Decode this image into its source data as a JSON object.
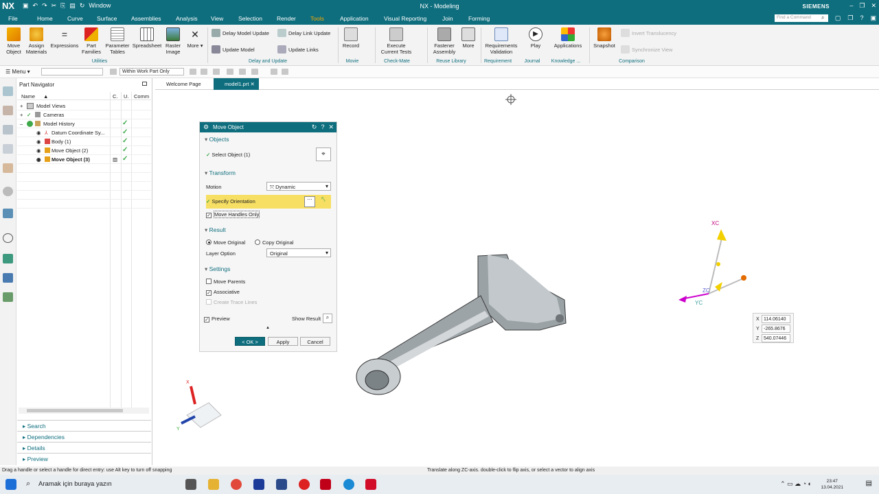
{
  "app": {
    "logo": "NX",
    "title": "NX - Modeling",
    "brand": "SIEMENS",
    "window_menu": "Window"
  },
  "menu_tabs": [
    "File",
    "Home",
    "Curve",
    "Surface",
    "Assemblies",
    "Analysis",
    "View",
    "Selection",
    "Render",
    "Tools",
    "Application",
    "Visual Reporting",
    "Join",
    "Forming"
  ],
  "active_tab": "Tools",
  "find_placeholder": "Find a Command",
  "ribbon": {
    "buttons": [
      "Move Object",
      "Assign Materials",
      "Expressions",
      "Part Families",
      "Parameter Tables",
      "Spreadsheet",
      "Raster Image",
      "More"
    ],
    "delay": [
      "Delay Model Update",
      "Delay Link Update",
      "Update Model",
      "Update Links"
    ],
    "record": "Record",
    "execute": "Execute Current Tests",
    "fastener": "Fastener Assembly",
    "more2": "More",
    "req": "Requirements Validation",
    "play": "Play",
    "applications": "Applications",
    "snapshot": "Snapshot",
    "invert": "Invert Translucency",
    "sync": "Synchronize View",
    "groups": [
      "Utilities",
      "Delay and Update",
      "Movie",
      "Check-Mate",
      "Reuse Library",
      "Requirement",
      "Journal",
      "Knowledge ...",
      "Comparison"
    ]
  },
  "toolbar": {
    "menu": "Menu",
    "scope": "Within Work Part Only"
  },
  "navigator": {
    "title": "Part Navigator",
    "cols": [
      "Name",
      "C.",
      "U.",
      "Comm"
    ],
    "rows": [
      "Model Views",
      "Cameras",
      "Model History",
      "Datum Coordinate Sy...",
      "Body (1)",
      "Move Object (2)",
      "Move Object (3)"
    ],
    "sections": [
      "Search",
      "Dependencies",
      "Details",
      "Preview"
    ]
  },
  "doctabs": [
    "Welcome Page",
    "model1.prt"
  ],
  "dialog": {
    "title": "Move Object",
    "objects": "Objects",
    "select_object": "Select Object (1)",
    "transform": "Transform",
    "motion_label": "Motion",
    "motion_value": "Dynamic",
    "specify_orientation": "Specify Orientation",
    "move_handles_only": "Move Handles Only",
    "result": "Result",
    "move_original": "Move Original",
    "copy_original": "Copy Original",
    "layer_option_label": "Layer Option",
    "layer_option_value": "Original",
    "settings": "Settings",
    "move_parents": "Move Parents",
    "associative": "Associative",
    "create_trace": "Create Trace Lines",
    "preview": "Preview",
    "show_result": "Show Result",
    "ok": "< OK >",
    "apply": "Apply",
    "cancel": "Cancel"
  },
  "handle_labels": {
    "xc": "XC",
    "yc": "YC",
    "zc": "ZC"
  },
  "coords": {
    "x": "114.06140",
    "y": "-265.8676",
    "z": "540.07446"
  },
  "triad": {
    "x": "X",
    "y": "Y"
  },
  "status": {
    "left": "Drag a handle or select a handle for direct entry: use Alt key to turn off snapping",
    "right": "Translate along ZC-axis. double-click to flip axis, or select a vector to align axis"
  },
  "taskbar": {
    "search": "Aramak için buraya yazın",
    "time": "23:47",
    "date": "13.04.2021"
  },
  "colors": {
    "accent": "#0e6e7e",
    "highlight": "#f7df63",
    "check": "#3fa84a"
  }
}
